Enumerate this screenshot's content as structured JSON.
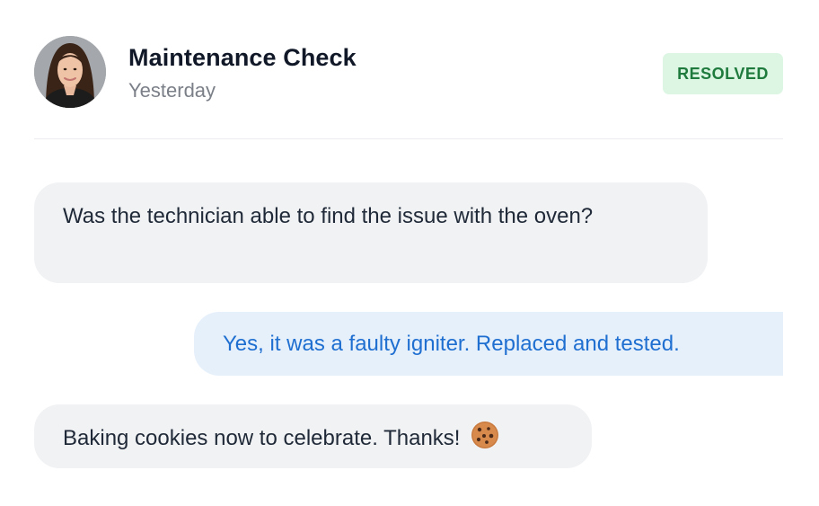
{
  "header": {
    "title": "Maintenance Check",
    "subtitle": "Yesterday",
    "status_badge": "RESOLVED"
  },
  "messages": [
    {
      "direction": "incoming",
      "text": "Was the technician able to find the issue with the oven?"
    },
    {
      "direction": "outgoing",
      "text": "Yes, it was a faulty igniter. Replaced and tested."
    },
    {
      "direction": "incoming",
      "text": "Baking cookies now to celebrate. Thanks!",
      "emoji": "cookie-icon"
    }
  ],
  "colors": {
    "badge_bg": "#dcf6e3",
    "badge_text": "#1f7a3d",
    "incoming_bg": "#f1f2f4",
    "outgoing_bg": "#e6f0fb",
    "outgoing_text": "#1f6fd1",
    "subtitle_text": "#7b7f87"
  }
}
